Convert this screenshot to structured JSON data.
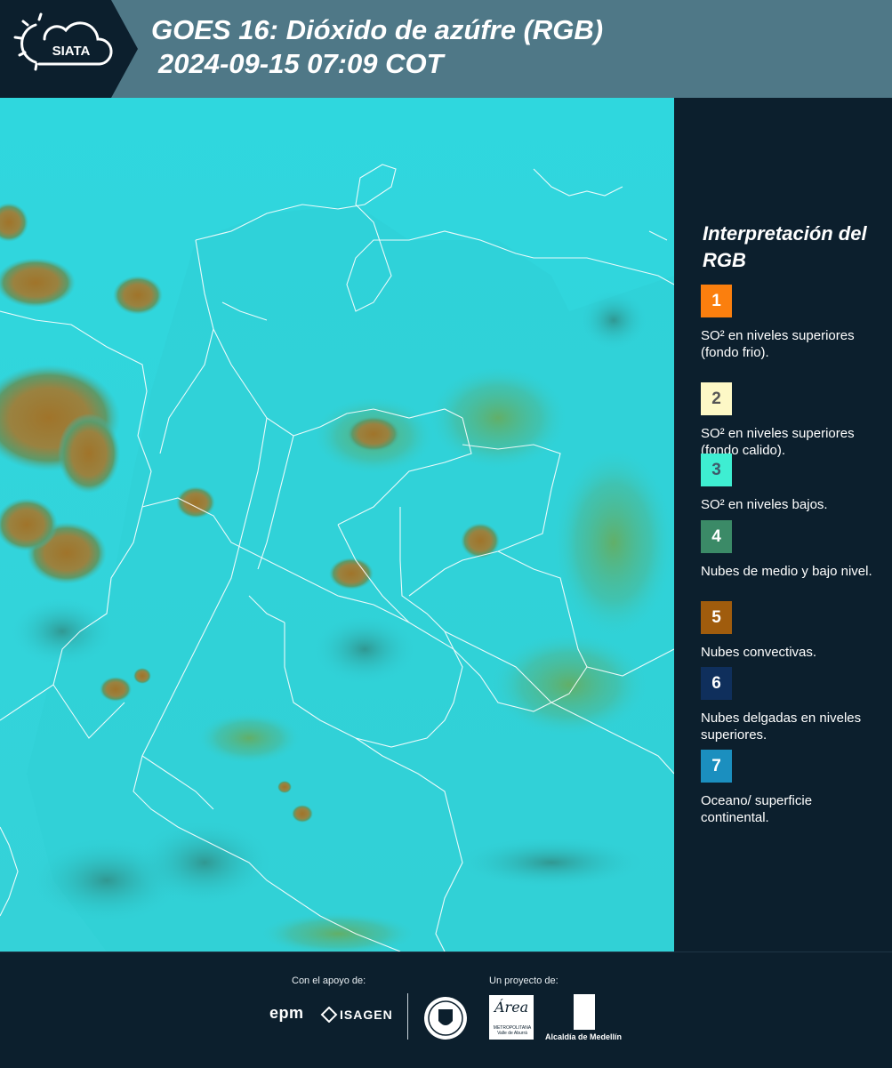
{
  "header": {
    "logo_text": "SIATA",
    "title_line1": "GOES 16: Dióxido de azúfre (RGB)",
    "title_line2": "2024-09-15 07:09 COT"
  },
  "legend": {
    "title": "Interpretación del RGB",
    "items": [
      {
        "number": "1",
        "color": "#fb7f0e",
        "number_color": "#ffffff",
        "text": "SO² en niveles superiores (fondo frio)."
      },
      {
        "number": "2",
        "color": "#fdf8c6",
        "number_color": "#555555",
        "text": "SO² en niveles superiores (fondo calido)."
      },
      {
        "number": "3",
        "color": "#3eeed2",
        "number_color": "#3e5a6a",
        "text": "SO² en niveles bajos."
      },
      {
        "number": "4",
        "color": "#3b8a67",
        "number_color": "#ffffff",
        "text": "Nubes de medio y bajo nivel."
      },
      {
        "number": "5",
        "color": "#a05c0d",
        "number_color": "#ffffff",
        "text": "Nubes convectivas."
      },
      {
        "number": "6",
        "color": "#0f2f5c",
        "number_color": "#ffffff",
        "text": "Nubes delgadas en niveles superiores."
      },
      {
        "number": "7",
        "color": "#1b8fbf",
        "number_color": "#ffffff",
        "text": "Oceano/ superficie continental."
      }
    ]
  },
  "footer": {
    "support_label": "Con el apoyo de:",
    "project_label": "Un proyecto de:",
    "sponsor1": "epm",
    "sponsor2": "ISAGEN",
    "area_word": "Área",
    "area_sub": "METROPOLITANA Valle de Aburrá",
    "alcaldia": "Alcaldía de Medellín"
  },
  "colors": {
    "background": "#0c1f2d",
    "header": "#4f7887",
    "map_base": "#2fd4dc",
    "convective_cloud": "#9a7a2a",
    "mid_low_cloud": "#3b8a67",
    "border_line": "#ffffff"
  }
}
